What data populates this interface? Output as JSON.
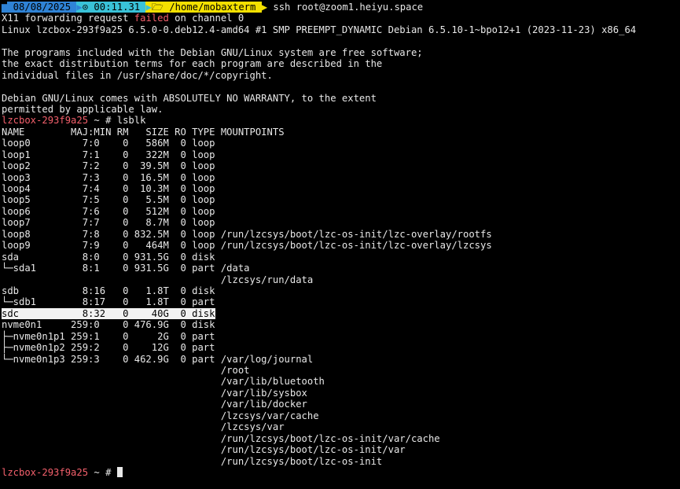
{
  "prompt_bar": {
    "date": " 08/08/2025 ",
    "time": " 00:11.31 ",
    "path": " /home/mobaxterm ",
    "command": " ssh root@zoom1.heiyu.space"
  },
  "x11": {
    "before": "X11 forwarding request ",
    "failed": "failed",
    "after": " on channel 0"
  },
  "banner": [
    "Linux lzcbox-293f9a25 6.5.0-0.deb12.4-amd64 #1 SMP PREEMPT_DYNAMIC Debian 6.5.10-1~bpo12+1 (2023-11-23) x86_64",
    "",
    "The programs included with the Debian GNU/Linux system are free software;",
    "the exact distribution terms for each program are described in the",
    "individual files in /usr/share/doc/*/copyright.",
    "",
    "Debian GNU/Linux comes with ABSOLUTELY NO WARRANTY, to the extent",
    "permitted by applicable law."
  ],
  "prompt1": {
    "host": "lzcbox-293f9a25",
    "rest": " ~ # ",
    "command": "lsblk"
  },
  "lsblk": {
    "header": "NAME        MAJ:MIN RM   SIZE RO TYPE MOUNTPOINTS",
    "rows": [
      "loop0         7:0    0   586M  0 loop",
      "loop1         7:1    0   322M  0 loop",
      "loop2         7:2    0  39.5M  0 loop",
      "loop3         7:3    0  16.5M  0 loop",
      "loop4         7:4    0  10.3M  0 loop",
      "loop5         7:5    0   5.5M  0 loop",
      "loop6         7:6    0   512M  0 loop",
      "loop7         7:7    0   8.7M  0 loop",
      "loop8         7:8    0 832.5M  0 loop /run/lzcsys/boot/lzc-os-init/lzc-overlay/rootfs",
      "loop9         7:9    0   464M  0 loop /run/lzcsys/boot/lzc-os-init/lzc-overlay/lzcsys",
      "sda           8:0    0 931.5G  0 disk",
      "└─sda1        8:1    0 931.5G  0 part /data",
      "                                      /lzcsys/run/data",
      "sdb           8:16   0   1.8T  0 disk",
      "└─sdb1        8:17   0   1.8T  0 part",
      "sdc           8:32   0    40G  0 disk",
      "nvme0n1     259:0    0 476.9G  0 disk",
      "├─nvme0n1p1 259:1    0     2G  0 part",
      "├─nvme0n1p2 259:2    0    12G  0 part",
      "└─nvme0n1p3 259:3    0 462.9G  0 part /var/log/journal",
      "                                      /root",
      "                                      /var/lib/bluetooth",
      "                                      /var/lib/sysbox",
      "                                      /var/lib/docker",
      "                                      /lzcsys/var/cache",
      "                                      /lzcsys/var",
      "                                      /run/lzcsys/boot/lzc-os-init/var/cache",
      "                                      /run/lzcsys/boot/lzc-os-init/var",
      "                                      /run/lzcsys/boot/lzc-os-init"
    ]
  },
  "prompt2": {
    "host": "lzcbox-293f9a25",
    "rest": " ~ # "
  }
}
